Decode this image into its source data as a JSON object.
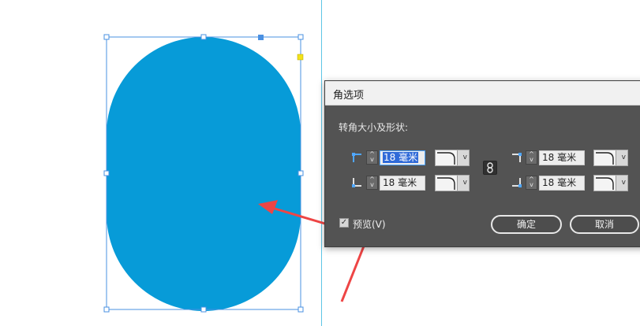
{
  "dialog": {
    "title": "角选项",
    "section_label": "转角大小及形状:",
    "corners": [
      {
        "name": "top-left",
        "value_number": "18",
        "value_unit": "毫米",
        "spin_up": "^",
        "spin_down": "v",
        "caret": "v"
      },
      {
        "name": "top-right",
        "value_number": "18",
        "value_unit": "毫米",
        "spin_up": "^",
        "spin_down": "v",
        "caret": "v"
      },
      {
        "name": "bottom-left",
        "value_number": "18",
        "value_unit": "毫米",
        "spin_up": "^",
        "spin_down": "v",
        "caret": "v"
      },
      {
        "name": "bottom-right",
        "value_number": "18",
        "value_unit": "毫米",
        "spin_up": "^",
        "spin_down": "v",
        "caret": "v"
      }
    ],
    "preview_checked_mark": "✓",
    "preview_label": "预览(V)",
    "ok_label": "确定",
    "cancel_label": "取消"
  },
  "colors": {
    "shape_fill": "#079bd8",
    "selection": "#4a90e2",
    "guide": "#5ec5e6",
    "arrow": "#ee4545",
    "dialog_bg": "#535353"
  },
  "icons": {
    "corner_icons": [
      "top-left-corner-icon",
      "top-right-corner-icon",
      "bottom-left-corner-icon",
      "bottom-right-corner-icon"
    ],
    "link": "link-chain-icon",
    "annotation": "red-arrow"
  }
}
